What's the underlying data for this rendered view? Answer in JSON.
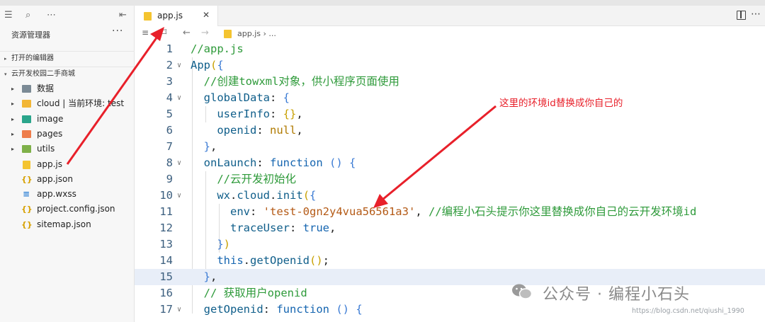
{
  "sidebar": {
    "title": "资源管理器",
    "more": "···",
    "sections": [
      {
        "label": "打开的编辑器",
        "caret": "▸"
      },
      {
        "label": "云开发校园二手商城",
        "caret": "▾"
      }
    ],
    "items": [
      {
        "label": "数据",
        "icon": "folder-icon",
        "kind": "folder",
        "arrow": "▸"
      },
      {
        "label": "cloud | 当前环境: test",
        "icon": "cloud-folder-icon",
        "kind": "cloud",
        "arrow": "▸"
      },
      {
        "label": "image",
        "icon": "image-folder-icon",
        "kind": "image",
        "arrow": "▸"
      },
      {
        "label": "pages",
        "icon": "pages-folder-icon",
        "kind": "pages",
        "arrow": "▸"
      },
      {
        "label": "utils",
        "icon": "utils-folder-icon",
        "kind": "utils",
        "arrow": "▸"
      },
      {
        "label": "app.js",
        "icon": "js-file-icon",
        "kind": "js",
        "arrow": ""
      },
      {
        "label": "app.json",
        "icon": "json-file-icon",
        "kind": "json",
        "arrow": ""
      },
      {
        "label": "app.wxss",
        "icon": "wxss-file-icon",
        "kind": "wxss",
        "arrow": ""
      },
      {
        "label": "project.config.json",
        "icon": "json-file-icon",
        "kind": "json",
        "arrow": ""
      },
      {
        "label": "sitemap.json",
        "icon": "json-file-icon",
        "kind": "json",
        "arrow": ""
      }
    ]
  },
  "tab": {
    "name": "app.js",
    "close": "✕"
  },
  "breadcrumb": {
    "file": "app.js",
    "sep": "›",
    "more": "..."
  },
  "code": {
    "lines": [
      {
        "n": "1",
        "fold": "",
        "html": "<span class='cm'>//app.js</span>"
      },
      {
        "n": "2",
        "fold": "∨",
        "html": "<span class='fn'>App</span><span class='br'>(</span><span class='br2'>{</span>"
      },
      {
        "n": "3",
        "fold": "",
        "html": "  <span class='cm'>//创建towxml对象，供小程序页面使用</span>"
      },
      {
        "n": "4",
        "fold": "∨",
        "html": "  <span class='prop'>globalData</span><span class='pl'>: </span><span class='br2'>{</span>"
      },
      {
        "n": "5",
        "fold": "",
        "html": "    <span class='prop'>userInfo</span><span class='pl'>: </span><span class='br'>{}</span><span class='pl'>,</span>"
      },
      {
        "n": "6",
        "fold": "",
        "html": "    <span class='prop'>openid</span><span class='pl'>: </span><span class='nul'>null</span><span class='pl'>,</span>"
      },
      {
        "n": "7",
        "fold": "",
        "html": "  <span class='br2'>}</span><span class='pl'>,</span>"
      },
      {
        "n": "8",
        "fold": "∨",
        "html": "  <span class='prop'>onLaunch</span><span class='pl'>: </span><span class='kw'>function</span><span class='pl'> </span><span class='br2'>()</span><span class='pl'> </span><span class='br2'>{</span>"
      },
      {
        "n": "9",
        "fold": "",
        "html": "    <span class='cm'>//云开发初始化</span>"
      },
      {
        "n": "10",
        "fold": "∨",
        "html": "    <span class='prop'>wx</span><span class='pl'>.</span><span class='prop'>cloud</span><span class='pl'>.</span><span class='fn'>init</span><span class='br'>(</span><span class='br2'>{</span>"
      },
      {
        "n": "11",
        "fold": "",
        "html": "      <span class='prop'>env</span><span class='pl'>: </span><span class='str'>'test-0gn2y4vua56561a3'</span><span class='pl'>, </span><span class='cm'>//编程小石头提示你这里替换成你自己的云开发环境id</span>"
      },
      {
        "n": "12",
        "fold": "",
        "html": "      <span class='prop'>traceUser</span><span class='pl'>: </span><span class='kw'>true</span><span class='pl'>,</span>"
      },
      {
        "n": "13",
        "fold": "",
        "html": "    <span class='br2'>}</span><span class='br'>)</span>"
      },
      {
        "n": "14",
        "fold": "",
        "html": "    <span class='this'>this</span><span class='pl'>.</span><span class='fn'>getOpenid</span><span class='br'>()</span><span class='pl'>;</span>"
      },
      {
        "n": "15",
        "fold": "",
        "html": "  <span class='br2'>}</span><span class='pl'>,</span>"
      },
      {
        "n": "16",
        "fold": "",
        "html": "  <span class='cm'>// 获取用户openid</span>"
      },
      {
        "n": "17",
        "fold": "∨",
        "html": "  <span class='prop'>getOpenid</span><span class='pl'>: </span><span class='kw'>function</span><span class='pl'> </span><span class='br2'>()</span><span class='pl'> </span><span class='br2'>{</span>"
      }
    ]
  },
  "annotation": "这里的环境id替换成你自己的",
  "watermark": {
    "text": "公众号 · 编程小石头",
    "url": "https://blog.csdn.net/qiushi_1990"
  },
  "colors": {
    "annotation_red": "#e8202a",
    "comment_green": "#2e9a3a",
    "keyword_blue": "#1565b0",
    "string_orange": "#b45a16"
  }
}
